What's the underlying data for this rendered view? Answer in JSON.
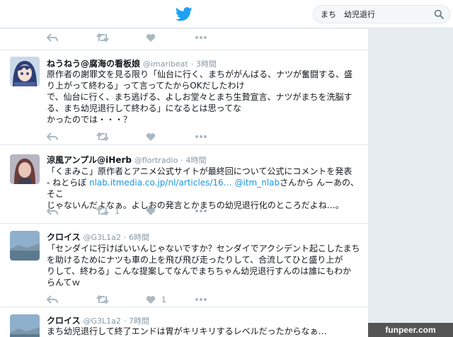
{
  "search": {
    "value": "まち　幼児退行"
  },
  "tweets": [
    {
      "name": "ねうねう@腐海の看板娘",
      "handle": "@imaribeat",
      "time": "3時間",
      "lines": [
        "原作者の謝罪文を見る限り「仙台に行く、まちががんばる、ナツが奮闘する、盛",
        "り上がって終わる」って言ってたからOKだしたわけ",
        "で、仙台に行く、まち逃げる、よしお堂々とまち生贄宣言、ナツがまちを洗脳す",
        "る、まち幼児退行して終わる」になるとは思ってな",
        "かったのでは・・・？"
      ],
      "retweets": "",
      "likes": ""
    },
    {
      "name": "涼風アンプル@iHerb",
      "handle": "@flortradio",
      "time": "4時間",
      "lines": [
        "「くまみこ」原作者とアニメ公式サイトが最終回について公式にコメントを発表",
        "- ねとらぼ ",
        "じゃないんだよなぁ。よしおの発言とかまちの幼児退行化のところだよね…。"
      ],
      "link": "nlab.itmedia.co.jp/nl/articles/16…",
      "mention": "@itm_nlab",
      "line2_tail": "さんから んーあの、そこ",
      "retweets": "1",
      "likes": ""
    },
    {
      "name": "クロイス",
      "handle": "@G3L1a2",
      "time": "6時間",
      "lines": [
        "「センダイに行けばいいんじゃないですか？センダイでアクシデント起こしたまち",
        "を助けるためにナツも車の上を飛び飛び走ったりして、合流してひと盛り上が",
        "りして、終わる」こんな提案してなんでまちちゃん幼児退行すんのは誰にもわか",
        "らんてｗ"
      ],
      "retweets": "",
      "likes": "1"
    },
    {
      "name": "クロイス",
      "handle": "@G3L1a2",
      "time": "7時間",
      "lines": [
        "まち幼児退行して終了エンドは胃がキリキリするレベルだったからなぁ…"
      ]
    }
  ],
  "watermark": "funpeer.com"
}
